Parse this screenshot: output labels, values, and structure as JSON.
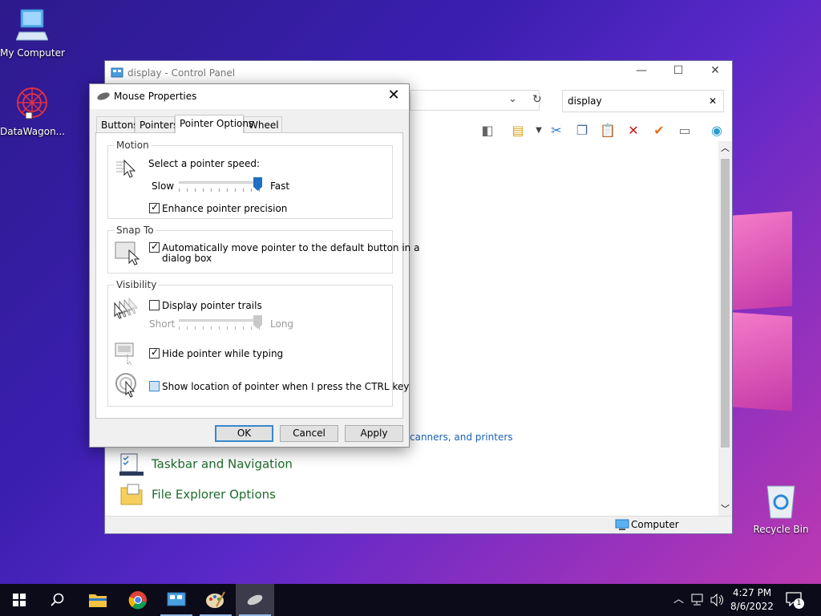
{
  "desktop": {
    "icons": [
      {
        "label": "My Computer"
      },
      {
        "label": "DataWagon..."
      },
      {
        "label": "Recycle Bin"
      }
    ]
  },
  "control_panel": {
    "title": "display - Control Panel",
    "search_value": "display",
    "items": [
      {
        "label": "Taskbar and Navigation"
      },
      {
        "label": "File Explorer Options"
      }
    ],
    "partial_link": "canners, and printers",
    "status_location": "Computer"
  },
  "mouse_dialog": {
    "title": "Mouse Properties",
    "tabs": [
      {
        "label": "Buttons",
        "active": false
      },
      {
        "label": "Pointers",
        "active": false
      },
      {
        "label": "Pointer Options",
        "active": true
      },
      {
        "label": "Wheel",
        "active": false
      }
    ],
    "motion": {
      "group_label": "Motion",
      "prompt": "Select a pointer speed:",
      "slow": "Slow",
      "fast": "Fast",
      "speed_fraction": 1.0,
      "enhance_label": "Enhance pointer precision",
      "enhance_checked": true
    },
    "snap_to": {
      "group_label": "Snap To",
      "auto_label_line1": "Automatically move pointer to the default button in a",
      "auto_label_line2": "dialog box",
      "auto_checked": true
    },
    "visibility": {
      "group_label": "Visibility",
      "trails_label": "Display pointer trails",
      "trails_checked": false,
      "short": "Short",
      "long": "Long",
      "trails_fraction": 1.0,
      "hide_label": "Hide pointer while typing",
      "hide_checked": true,
      "ctrl_label": "Show location of pointer when I press the CTRL key",
      "ctrl_checked": false
    },
    "buttons": {
      "ok": "OK",
      "cancel": "Cancel",
      "apply": "Apply"
    }
  },
  "taskbar": {
    "time": "4:27 PM",
    "date": "8/6/2022",
    "notification_count": "1"
  },
  "colors": {
    "accent": "#1f6fc5",
    "link_green": "#1e6b2e",
    "link_blue": "#1a5fb4"
  }
}
